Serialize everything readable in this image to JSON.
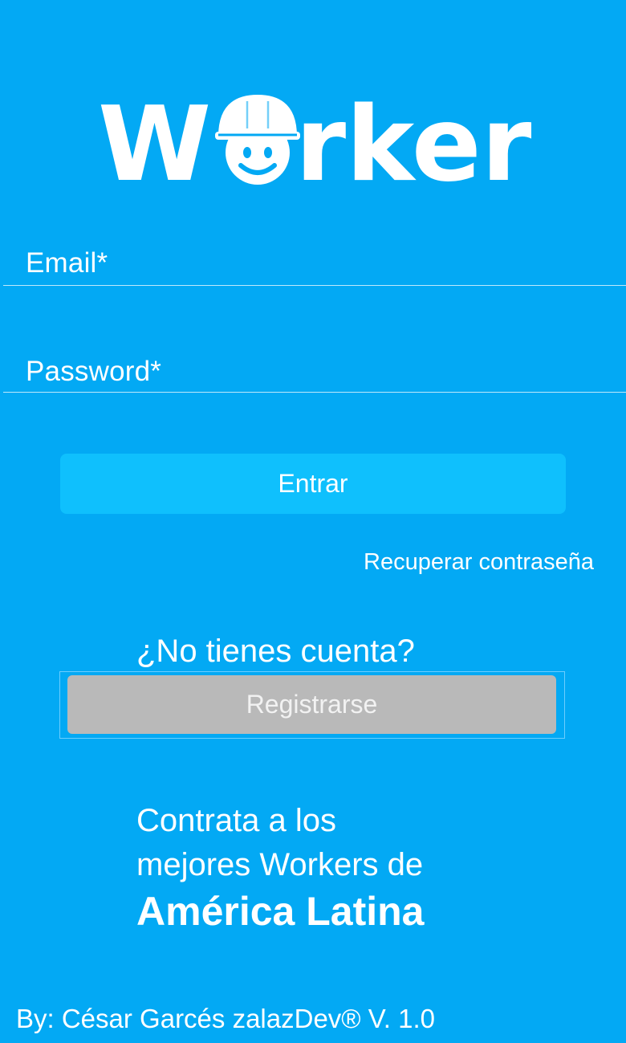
{
  "brand": {
    "logo_text": "Worker",
    "background_color": "#03a9f4",
    "logo_icon": "smiling-worker-helmet-icon"
  },
  "login_form": {
    "email_label": "Email*",
    "password_label": "Password*",
    "submit_label": "Entrar",
    "submit_color": "#0fc0fd",
    "recover_link": "Recuperar contraseña"
  },
  "signup": {
    "prompt": "¿No tienes cuenta?",
    "button_label": "Registrarse",
    "button_color": "#b9b9b9"
  },
  "tagline": {
    "line1": "Contrata a los",
    "line2": "mejores Workers de",
    "line3": "América Latina"
  },
  "footer": {
    "credit": "By: César Garcés zalazDev® V. 1.0"
  }
}
